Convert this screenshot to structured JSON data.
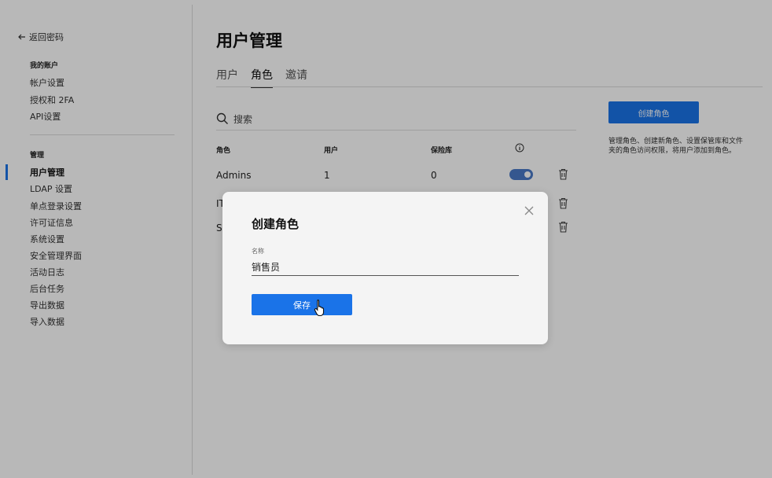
{
  "sidebar": {
    "back_label": "返回密码",
    "my_account": {
      "title": "我的账户",
      "items": [
        "帐户设置",
        "授权和 2FA",
        "API设置"
      ]
    },
    "manage": {
      "title": "管理",
      "items": [
        "用户管理",
        "LDAP 设置",
        "单点登录设置",
        "许可证信息",
        "系统设置",
        "安全管理界面",
        "活动日志",
        "后台任务",
        "导出数据",
        "导入数据"
      ]
    }
  },
  "main": {
    "title": "用户管理",
    "tabs": [
      {
        "label": "用户",
        "active": false
      },
      {
        "label": "角色",
        "active": true
      },
      {
        "label": "邀请",
        "active": false
      }
    ],
    "search_placeholder": "搜索",
    "table": {
      "headers": [
        "角色",
        "用户",
        "保险库"
      ],
      "rows": [
        {
          "role": "Admins",
          "users": "1",
          "vaults": "0"
        },
        {
          "role": "IT",
          "users": "",
          "vaults": ""
        },
        {
          "role": "S",
          "users": "",
          "vaults": ""
        }
      ]
    },
    "create_role_button": "创建角色",
    "help_text": "管理角色、创建新角色、设置保管库和文件夹的角色访问权限，将用户添加到角色。"
  },
  "modal": {
    "title": "创建角色",
    "field_label": "名称",
    "field_value": "销售员",
    "save_label": "保存"
  },
  "colors": {
    "accent": "#1a73e8",
    "toggle_on": "#4a79c7"
  }
}
